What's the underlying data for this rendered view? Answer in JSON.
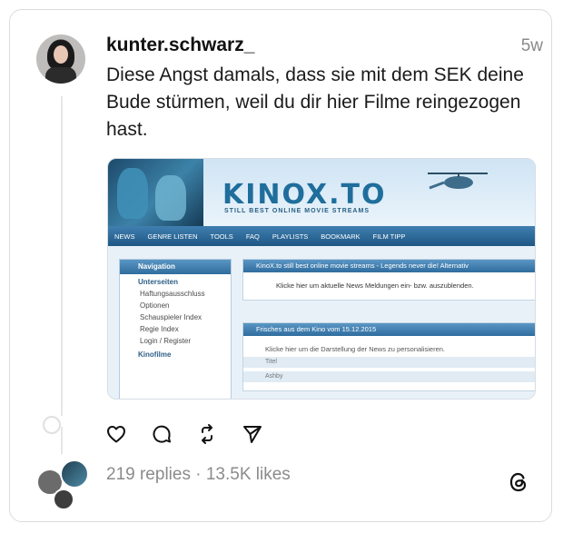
{
  "post": {
    "username": "kunter.schwarz_",
    "time": "5w",
    "text": "Diese Angst damals, dass sie mit dem SEK deine Bude stürmen, weil du dir hier Filme reingezogen hast."
  },
  "screenshot": {
    "logo": "KINOX.TO",
    "tagline": "STILL BEST ONLINE MOVIE STREAMS",
    "nav": [
      "NEWS",
      "GENRE LISTEN",
      "TOOLS",
      "FAQ",
      "PLAYLISTS",
      "BOOKMARK",
      "FILM TIPP"
    ],
    "sidebar": {
      "header": "Navigation",
      "section1": "Unterseiten",
      "items": [
        "Haftungsausschluss",
        "Optionen",
        "Schauspieler Index",
        "Regie Index",
        "Login / Register"
      ],
      "section2": "Kinofilme"
    },
    "panel1": {
      "header": "KinoX.to still best online movie streams - Legends never die! Alternativ",
      "body": "Klicke hier um aktuelle News Meldungen ein- bzw. auszublenden."
    },
    "panel2": {
      "header": "Frisches aus dem Kino vom 15.12.2015",
      "body": "Klicke hier um die Darstellung der News zu personalisieren.",
      "column": "Titel",
      "row": "Ashby"
    }
  },
  "stats": {
    "text": "219 replies · 13.5K likes"
  },
  "icons": {
    "like": "heart-icon",
    "reply": "comment-icon",
    "repost": "repost-icon",
    "share": "send-icon",
    "brand": "threads-logo-icon"
  }
}
